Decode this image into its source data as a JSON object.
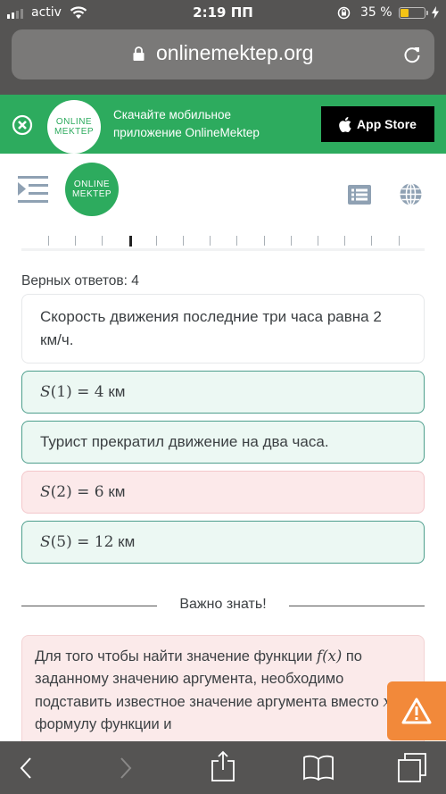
{
  "status_bar": {
    "carrier": "activ",
    "time": "2:19 ПП",
    "battery_percent_label": "35 %",
    "battery_level": 0.35,
    "signal_bars_active": 2,
    "signal_bars_total": 4
  },
  "browser": {
    "url": "onlinemektep.org"
  },
  "app_banner": {
    "logo_line1": "ONLINE",
    "logo_line2": "MEKTEP",
    "text_line1": "Скачайте мобильное",
    "text_line2": "приложение OnlineMektep",
    "store_button_label": "App Store"
  },
  "header": {
    "logo_line1": "ONLINE",
    "logo_line2": "MEKTEP"
  },
  "progress": {
    "total_steps": 14,
    "current_step": 4
  },
  "quiz": {
    "correct_count_label": "Верных ответов: 4",
    "answers": [
      {
        "text": "Скорость движения последние три часа равна 2 км/ч.",
        "state": "neutral",
        "is_math": false
      },
      {
        "math_fn": "S",
        "math_arg": "(1)",
        "math_rest": " = 4",
        "unit": " км",
        "state": "correct",
        "is_math": true
      },
      {
        "text": "Турист прекратил движение на два часа.",
        "state": "correct",
        "is_math": false
      },
      {
        "math_fn": "S",
        "math_arg": "(2)",
        "math_rest": " = 6",
        "unit": " км",
        "state": "wrong",
        "is_math": true
      },
      {
        "math_fn": "S",
        "math_arg": "(5)",
        "math_rest": " = 12",
        "unit": " км",
        "state": "correct",
        "is_math": true
      }
    ]
  },
  "important": {
    "label": "Важно знать!",
    "text_part1": "Для того чтобы найти значение функции ",
    "text_math1": "f(x)",
    "text_part2": " по заданному значению аргумента, необходимо подставить известное значение аргумента вместо ",
    "text_math2": "x",
    "text_part3": " в формулу функции и"
  },
  "colors": {
    "brand_green": "#2dab5e",
    "correct_bg": "#ecf8f3",
    "correct_border": "#4d9e8c",
    "wrong_bg": "#fce9ea",
    "report_orange": "#f2893a"
  }
}
